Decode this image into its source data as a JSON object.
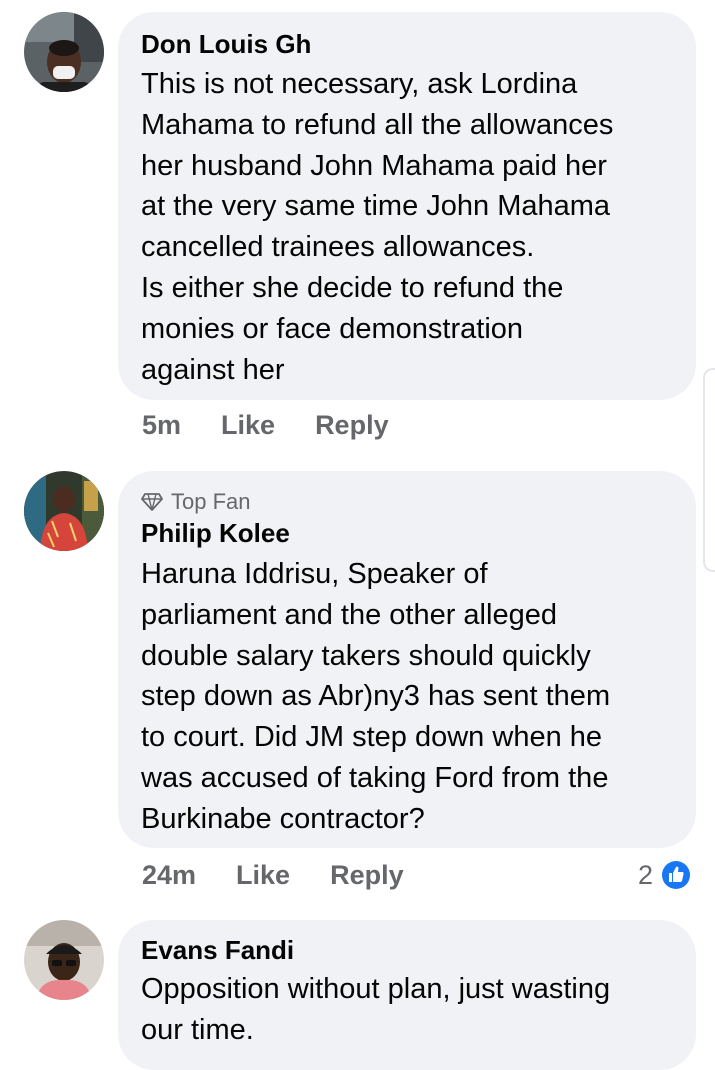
{
  "comments": [
    {
      "author": "Don Louis Gh",
      "badge": "",
      "text": "This is not necessary, ask Lordina\nMahama to refund all the allowances\nher husband John Mahama paid her\nat the very same time John Mahama\ncancelled trainees allowances.\nIs either she decide to refund the\nmonies or face demonstration\nagainst her",
      "time": "5m",
      "like_label": "Like",
      "reply_label": "Reply",
      "reaction_count": "",
      "avatar_icon": "avatar-man-mask"
    },
    {
      "author": "Philip Kolee",
      "badge": "Top Fan",
      "badge_icon": "diamond-icon",
      "text": "Haruna Iddrisu, Speaker of\nparliament and the other alleged\ndouble salary takers should quickly\nstep down as Abr)ny3 has sent them\nto court.  Did JM step down when he\nwas accused of taking Ford from the\nBurkinabe contractor?",
      "time": "24m",
      "like_label": "Like",
      "reply_label": "Reply",
      "reaction_count": "2",
      "reaction_icon": "like-reaction-icon",
      "avatar_icon": "avatar-man-red-shirt"
    },
    {
      "author": "Evans Fandi",
      "badge": "",
      "text": "Opposition without plan, just wasting\nour time.",
      "time": "",
      "like_label": "",
      "reply_label": "",
      "reaction_count": "",
      "avatar_icon": "avatar-man-cap"
    }
  ],
  "colors": {
    "bubble": "#f0f2f5",
    "meta_text": "#65676b",
    "like_blue": "#1877f2"
  }
}
